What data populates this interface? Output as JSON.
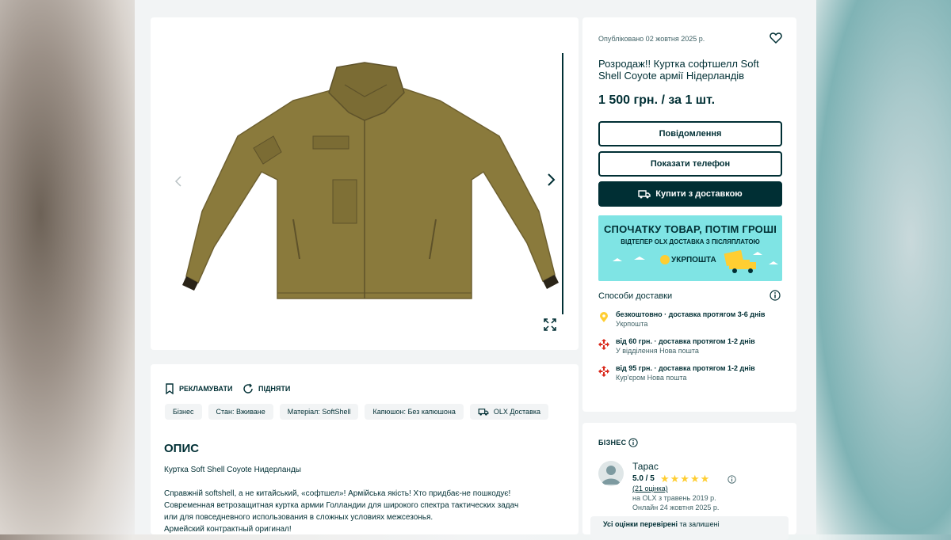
{
  "listing": {
    "published": "Опубліковано 02 жовтня 2025 р.",
    "title": "Розродаж!! Куртка софтшелл Soft Shell Coyote армії Нідерландів",
    "price": "1 500 грн. / за 1 шт."
  },
  "buttons": {
    "message": "Повідомлення",
    "show_phone": "Показати телефон",
    "buy_delivery": "Купити з доставкою"
  },
  "promo": {
    "headline": "СПОЧАТКУ ТОВАР, ПОТІМ ГРОШІ",
    "subline": "ВІДТЕПЕР OLX ДОСТАВКА З ПІСЛЯПЛАТОЮ",
    "logo": "УКРПОШТА"
  },
  "shipping": {
    "heading": "Способи доставки",
    "options": [
      {
        "title": "безкоштовно · доставка протягом 3-6 днів",
        "carrier": "Укрпошта",
        "icon": "ukrposhta-pin-icon"
      },
      {
        "title": "від 60 грн. · доставка протягом 1-2 днів",
        "carrier": "У відділення Нова пошта",
        "icon": "nova-poshta-icon"
      },
      {
        "title": "від 95 грн. · доставка протягом 1-2 днів",
        "carrier": "Кур'єром Нова пошта",
        "icon": "nova-poshta-icon"
      }
    ]
  },
  "actions": {
    "promote": "РЕКЛАМУВАТИ",
    "raise": "ПІДНЯТИ"
  },
  "tags": [
    "Бізнес",
    "Стан: Вживане",
    "Матеріал: SoftShell",
    "Капюшон: Без капюшона",
    "OLX Доставка"
  ],
  "description": {
    "heading": "ОПИС",
    "lines": [
      "Куртка Soft Shell Coyote Нидерланды",
      "Справжній softshell, а не китайський, «софтшел»! Армійська якість! Хто придбає-не пошкодує!",
      "Современная ветрозащитная куртка армии Голландии для широкого спектра тактических задач",
      "или для повседневного использования в сложных условиях межсезонья.",
      "Армейский контрактный оригинал!"
    ]
  },
  "business": {
    "heading": "БІЗНЕС",
    "seller_name": "Тарас",
    "rating": "5.0 / 5",
    "stars": 5,
    "reviews": "(21 оцінка)",
    "since": "на OLX з травень 2019 р.",
    "online": "Онлайн 24 жовтня 2025 р.",
    "verified_bold": "Усі оцінки перевірені",
    "verified_rest": " та залишені"
  },
  "colors": {
    "brand_dark": "#002f34",
    "promo_bg": "#7fe4e4",
    "star": "#ffce32",
    "jacket": "#8a7a3c"
  }
}
